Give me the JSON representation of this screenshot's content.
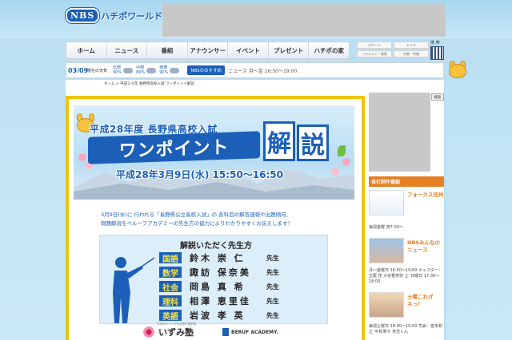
{
  "header": {
    "logo_nbs": "NBS",
    "logo_text": "ハチポワールド"
  },
  "nav": {
    "items": [
      "ホーム",
      "ニュース",
      "番組",
      "アナウンサー",
      "イベント",
      "プレゼント",
      "ハチポの家"
    ]
  },
  "util": {
    "sports": "スポーツ",
    "drama": "ドラマ",
    "variety": "バラエティ・情報",
    "special": "特番・特集",
    "qr_label": "携 帯"
  },
  "weather": {
    "date": "03/09",
    "label": "現在の天気",
    "regions": [
      {
        "name": "北部",
        "pct": "90%"
      },
      {
        "name": "中部",
        "pct": "80%"
      },
      {
        "name": "南部",
        "pct": "90%"
      }
    ],
    "reco_label": "NBSのおすすめ",
    "reco_text": "ニュース 月〜金 16:50〜19:00"
  },
  "breadcrumb": "ホーム > 平成２８年 長野県高校入試 ワンポイント解説",
  "poster": {
    "title1": "平成28年度 長野県高校入試",
    "title2": "ワンポイント",
    "kai": "解",
    "setsu": "説",
    "date": "平成28年3月9日(水) 15:50〜16:50",
    "intro_line1": "3月9日(水)に 行われる「長野県公立高校入試」の 各科目の解答速報や出題傾向、",
    "intro_line2": "問題解説をベルーフアカデミーの先生方の協力によりわかりやすくお伝えします！",
    "teachers_title": "解説いただく先生方",
    "sensei": "先生",
    "teachers": [
      {
        "subject": "国語",
        "name": "鈴木 崇 仁"
      },
      {
        "subject": "数学",
        "name": "諏訪 保奈美"
      },
      {
        "subject": "社会",
        "name": "岡島 真 希"
      },
      {
        "subject": "理科",
        "name": "相澤 恵里佳"
      },
      {
        "subject": "英語",
        "name": "岩波 孝 英"
      }
    ],
    "izumi": "いずみ塾",
    "izumi_sub": "平均点のトップを目指す進学塾",
    "beruf": "BERUF ACADEMY."
  },
  "sidebar": {
    "search": "検索",
    "own_header": "自社制作番組",
    "programs": [
      {
        "title": "フォーカス",
        "title2": "信州",
        "desc": "毎週金曜 夜7:00〜"
      },
      {
        "title": "NBSみんなの",
        "title2": "ニュース",
        "desc": "月〜金曜日 16:50〜19:00 キャスター：古尾 佳 大谷香奈弥 土･日曜日 17:30〜18:00"
      },
      {
        "title": "土曜これダ",
        "title2": "ネっ！",
        "desc": "毎週土曜日 18:00〜19:00 司会：宮本和之･平松果々 末吉くん"
      }
    ]
  },
  "colors": {
    "brand_blue": "#1b5fb8",
    "accent_yellow": "#f0c400",
    "accent_orange": "#e67e22"
  }
}
